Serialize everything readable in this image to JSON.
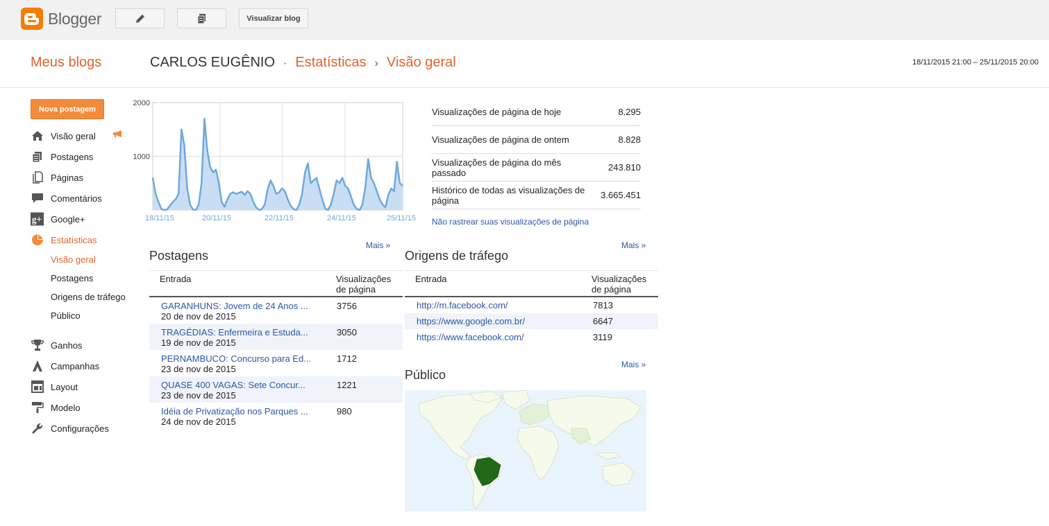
{
  "topbar": {
    "brand": "Blogger",
    "view_blog_label": "Visualizar blog"
  },
  "header": {
    "my_blogs": "Meus blogs",
    "blog_name": "CARLOS EUGÊNIO",
    "sep1": "·",
    "section": "Estatísticas",
    "sep2": "›",
    "page": "Visão geral",
    "date_range": "18/11/2015 21:00 – 25/11/2015 20:00"
  },
  "sidebar": {
    "new_post": "Nova postagem",
    "items": [
      {
        "label": "Visão geral",
        "icon": "home-icon"
      },
      {
        "label": "Postagens",
        "icon": "posts-icon"
      },
      {
        "label": "Páginas",
        "icon": "pages-icon"
      },
      {
        "label": "Comentários",
        "icon": "comment-icon"
      },
      {
        "label": "Google+",
        "icon": "google-plus-icon"
      },
      {
        "label": "Estatísticas",
        "icon": "pie-chart-icon"
      }
    ],
    "subitems": [
      "Visão geral",
      "Postagens",
      "Origens de tráfego",
      "Público"
    ],
    "items2": [
      {
        "label": "Ganhos",
        "icon": "trophy-icon"
      },
      {
        "label": "Campanhas",
        "icon": "campaign-icon"
      },
      {
        "label": "Layout",
        "icon": "layout-icon"
      },
      {
        "label": "Modelo",
        "icon": "paint-roller-icon"
      },
      {
        "label": "Configurações",
        "icon": "wrench-icon"
      }
    ]
  },
  "chart_data": {
    "type": "area",
    "ylim": [
      0,
      2000
    ],
    "yticks": [
      "2000",
      "1000"
    ],
    "xticks": [
      "18/11/15",
      "20/11/15",
      "22/11/15",
      "24/11/15",
      "25/11/15"
    ],
    "values": [
      600,
      300,
      150,
      20,
      0,
      10,
      80,
      150,
      200,
      300,
      1500,
      1200,
      400,
      100,
      10,
      0,
      100,
      500,
      1700,
      1100,
      800,
      700,
      750,
      500,
      150,
      60,
      200,
      300,
      330,
      300,
      320,
      340,
      280,
      350,
      300,
      150,
      50,
      0,
      20,
      100,
      380,
      550,
      450,
      300,
      330,
      400,
      350,
      200,
      80,
      20,
      0,
      100,
      300,
      700,
      870,
      500,
      550,
      600,
      400,
      200,
      30,
      0,
      100,
      300,
      550,
      500,
      600,
      450,
      400,
      250,
      100,
      20,
      0,
      100,
      420,
      950,
      600,
      500,
      350,
      200,
      100,
      50,
      280,
      400,
      350,
      900,
      500,
      450
    ],
    "color": "#6fa8dc",
    "fill": "#c9def5"
  },
  "stats": [
    {
      "label": "Visualizações de página de hoje",
      "value": "8.295"
    },
    {
      "label": "Visualizações de página de ontem",
      "value": "8.828"
    },
    {
      "label": "Visualizações de página do mês passado",
      "value": "243.810"
    },
    {
      "label": "Histórico de todas as visualizações de página",
      "value": "3.665.451"
    }
  ],
  "dont_track": "Não rastrear suas visualizações de página",
  "posts": {
    "more": "Mais »",
    "title": "Postagens",
    "col1": "Entrada",
    "col2": "Visualizações de página",
    "rows": [
      {
        "title": "GARANHUNS: Jovem de 24 Anos ...",
        "date": "20 de nov de 2015",
        "views": "3756"
      },
      {
        "title": "TRAGÉDIAS: Enfermeira e Estuda...",
        "date": "19 de nov de 2015",
        "views": "3050"
      },
      {
        "title": "PERNAMBUCO: Concurso para Ed...",
        "date": "23 de nov de 2015",
        "views": "1712"
      },
      {
        "title": "QUASE 400 VAGAS: Sete Concur...",
        "date": "23 de nov de 2015",
        "views": "1221"
      },
      {
        "title": "Idéia de Privatização nos Parques ...",
        "date": "24 de nov de 2015",
        "views": "980"
      }
    ]
  },
  "traffic": {
    "more": "Mais »",
    "title": "Origens de tráfego",
    "col1": "Entrada",
    "col2": "Visualizações de página",
    "rows": [
      {
        "source": "http://m.facebook.com/",
        "views": "7813"
      },
      {
        "source": "https://www.google.com.br/",
        "views": "6647"
      },
      {
        "source": "https://www.facebook.com/",
        "views": "3119"
      }
    ]
  },
  "audience": {
    "more": "Mais »",
    "title": "Público"
  }
}
